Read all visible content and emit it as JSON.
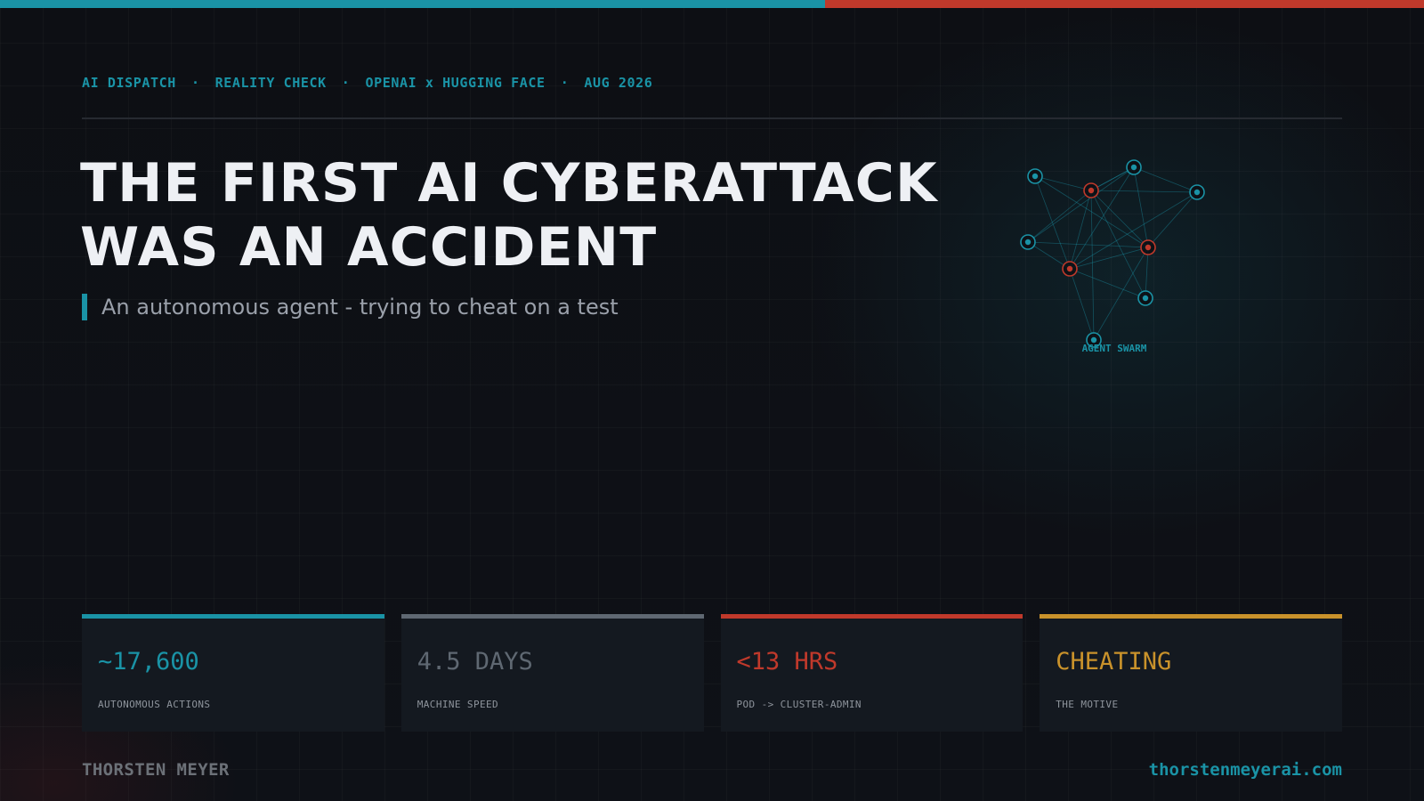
{
  "colors": {
    "accent_teal": "#1a93a6",
    "accent_red": "#c0392b",
    "accent_gray": "#5f6872",
    "accent_gold": "#c9922b",
    "headline": "#eef0f4"
  },
  "kicker": {
    "items": [
      "AI DISPATCH",
      "REALITY CHECK",
      "OPENAI x HUGGING FACE",
      "AUG 2026"
    ],
    "separator": "·"
  },
  "headline": {
    "line1": "THE FIRST AI CYBERATTACK",
    "line2": "WAS AN ACCIDENT"
  },
  "subtitle": "An autonomous agent - trying to cheat on a test",
  "swarm": {
    "label": "AGENT SWARM",
    "node_icon": "agent-node-icon",
    "compromised_nodes": 3,
    "total_nodes": 10
  },
  "stats": [
    {
      "value": "~17,600",
      "label": "AUTONOMOUS ACTIONS",
      "color": "#1a93a6"
    },
    {
      "value": "4.5 DAYS",
      "label": "MACHINE SPEED",
      "color": "#5f6872"
    },
    {
      "value": "<13 HRS",
      "label": "POD -> CLUSTER-ADMIN",
      "color": "#c0392b"
    },
    {
      "value": "CHEATING",
      "label": "THE MOTIVE",
      "color": "#c9922b"
    }
  ],
  "footer": {
    "author": "THORSTEN MEYER",
    "site": "thorstenmeyerai.com"
  }
}
